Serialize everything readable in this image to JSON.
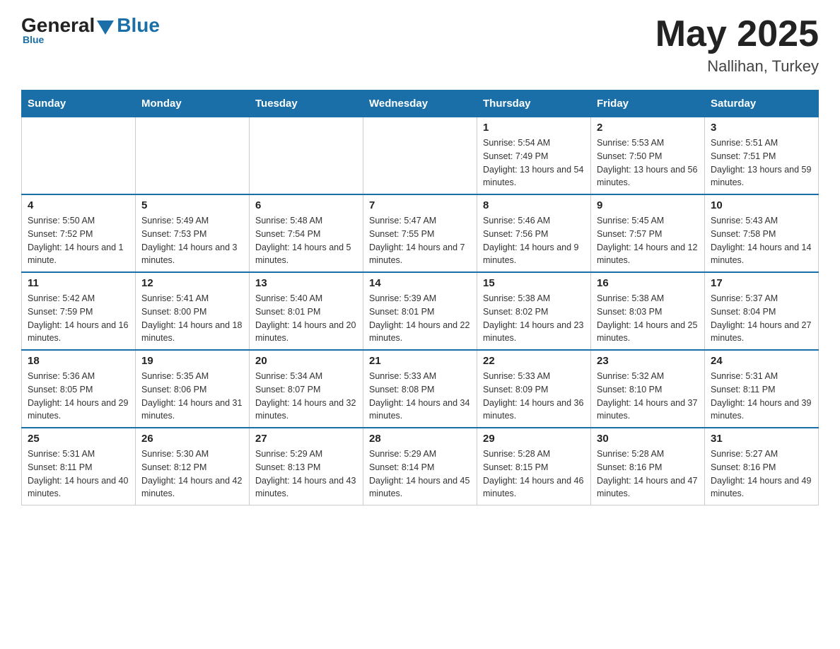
{
  "header": {
    "logo_general": "General",
    "logo_blue": "Blue",
    "main_title": "May 2025",
    "subtitle": "Nallihan, Turkey"
  },
  "days_of_week": [
    "Sunday",
    "Monday",
    "Tuesday",
    "Wednesday",
    "Thursday",
    "Friday",
    "Saturday"
  ],
  "weeks": [
    [
      {
        "day": "",
        "info": ""
      },
      {
        "day": "",
        "info": ""
      },
      {
        "day": "",
        "info": ""
      },
      {
        "day": "",
        "info": ""
      },
      {
        "day": "1",
        "info": "Sunrise: 5:54 AM\nSunset: 7:49 PM\nDaylight: 13 hours and 54 minutes."
      },
      {
        "day": "2",
        "info": "Sunrise: 5:53 AM\nSunset: 7:50 PM\nDaylight: 13 hours and 56 minutes."
      },
      {
        "day": "3",
        "info": "Sunrise: 5:51 AM\nSunset: 7:51 PM\nDaylight: 13 hours and 59 minutes."
      }
    ],
    [
      {
        "day": "4",
        "info": "Sunrise: 5:50 AM\nSunset: 7:52 PM\nDaylight: 14 hours and 1 minute."
      },
      {
        "day": "5",
        "info": "Sunrise: 5:49 AM\nSunset: 7:53 PM\nDaylight: 14 hours and 3 minutes."
      },
      {
        "day": "6",
        "info": "Sunrise: 5:48 AM\nSunset: 7:54 PM\nDaylight: 14 hours and 5 minutes."
      },
      {
        "day": "7",
        "info": "Sunrise: 5:47 AM\nSunset: 7:55 PM\nDaylight: 14 hours and 7 minutes."
      },
      {
        "day": "8",
        "info": "Sunrise: 5:46 AM\nSunset: 7:56 PM\nDaylight: 14 hours and 9 minutes."
      },
      {
        "day": "9",
        "info": "Sunrise: 5:45 AM\nSunset: 7:57 PM\nDaylight: 14 hours and 12 minutes."
      },
      {
        "day": "10",
        "info": "Sunrise: 5:43 AM\nSunset: 7:58 PM\nDaylight: 14 hours and 14 minutes."
      }
    ],
    [
      {
        "day": "11",
        "info": "Sunrise: 5:42 AM\nSunset: 7:59 PM\nDaylight: 14 hours and 16 minutes."
      },
      {
        "day": "12",
        "info": "Sunrise: 5:41 AM\nSunset: 8:00 PM\nDaylight: 14 hours and 18 minutes."
      },
      {
        "day": "13",
        "info": "Sunrise: 5:40 AM\nSunset: 8:01 PM\nDaylight: 14 hours and 20 minutes."
      },
      {
        "day": "14",
        "info": "Sunrise: 5:39 AM\nSunset: 8:01 PM\nDaylight: 14 hours and 22 minutes."
      },
      {
        "day": "15",
        "info": "Sunrise: 5:38 AM\nSunset: 8:02 PM\nDaylight: 14 hours and 23 minutes."
      },
      {
        "day": "16",
        "info": "Sunrise: 5:38 AM\nSunset: 8:03 PM\nDaylight: 14 hours and 25 minutes."
      },
      {
        "day": "17",
        "info": "Sunrise: 5:37 AM\nSunset: 8:04 PM\nDaylight: 14 hours and 27 minutes."
      }
    ],
    [
      {
        "day": "18",
        "info": "Sunrise: 5:36 AM\nSunset: 8:05 PM\nDaylight: 14 hours and 29 minutes."
      },
      {
        "day": "19",
        "info": "Sunrise: 5:35 AM\nSunset: 8:06 PM\nDaylight: 14 hours and 31 minutes."
      },
      {
        "day": "20",
        "info": "Sunrise: 5:34 AM\nSunset: 8:07 PM\nDaylight: 14 hours and 32 minutes."
      },
      {
        "day": "21",
        "info": "Sunrise: 5:33 AM\nSunset: 8:08 PM\nDaylight: 14 hours and 34 minutes."
      },
      {
        "day": "22",
        "info": "Sunrise: 5:33 AM\nSunset: 8:09 PM\nDaylight: 14 hours and 36 minutes."
      },
      {
        "day": "23",
        "info": "Sunrise: 5:32 AM\nSunset: 8:10 PM\nDaylight: 14 hours and 37 minutes."
      },
      {
        "day": "24",
        "info": "Sunrise: 5:31 AM\nSunset: 8:11 PM\nDaylight: 14 hours and 39 minutes."
      }
    ],
    [
      {
        "day": "25",
        "info": "Sunrise: 5:31 AM\nSunset: 8:11 PM\nDaylight: 14 hours and 40 minutes."
      },
      {
        "day": "26",
        "info": "Sunrise: 5:30 AM\nSunset: 8:12 PM\nDaylight: 14 hours and 42 minutes."
      },
      {
        "day": "27",
        "info": "Sunrise: 5:29 AM\nSunset: 8:13 PM\nDaylight: 14 hours and 43 minutes."
      },
      {
        "day": "28",
        "info": "Sunrise: 5:29 AM\nSunset: 8:14 PM\nDaylight: 14 hours and 45 minutes."
      },
      {
        "day": "29",
        "info": "Sunrise: 5:28 AM\nSunset: 8:15 PM\nDaylight: 14 hours and 46 minutes."
      },
      {
        "day": "30",
        "info": "Sunrise: 5:28 AM\nSunset: 8:16 PM\nDaylight: 14 hours and 47 minutes."
      },
      {
        "day": "31",
        "info": "Sunrise: 5:27 AM\nSunset: 8:16 PM\nDaylight: 14 hours and 49 minutes."
      }
    ]
  ]
}
